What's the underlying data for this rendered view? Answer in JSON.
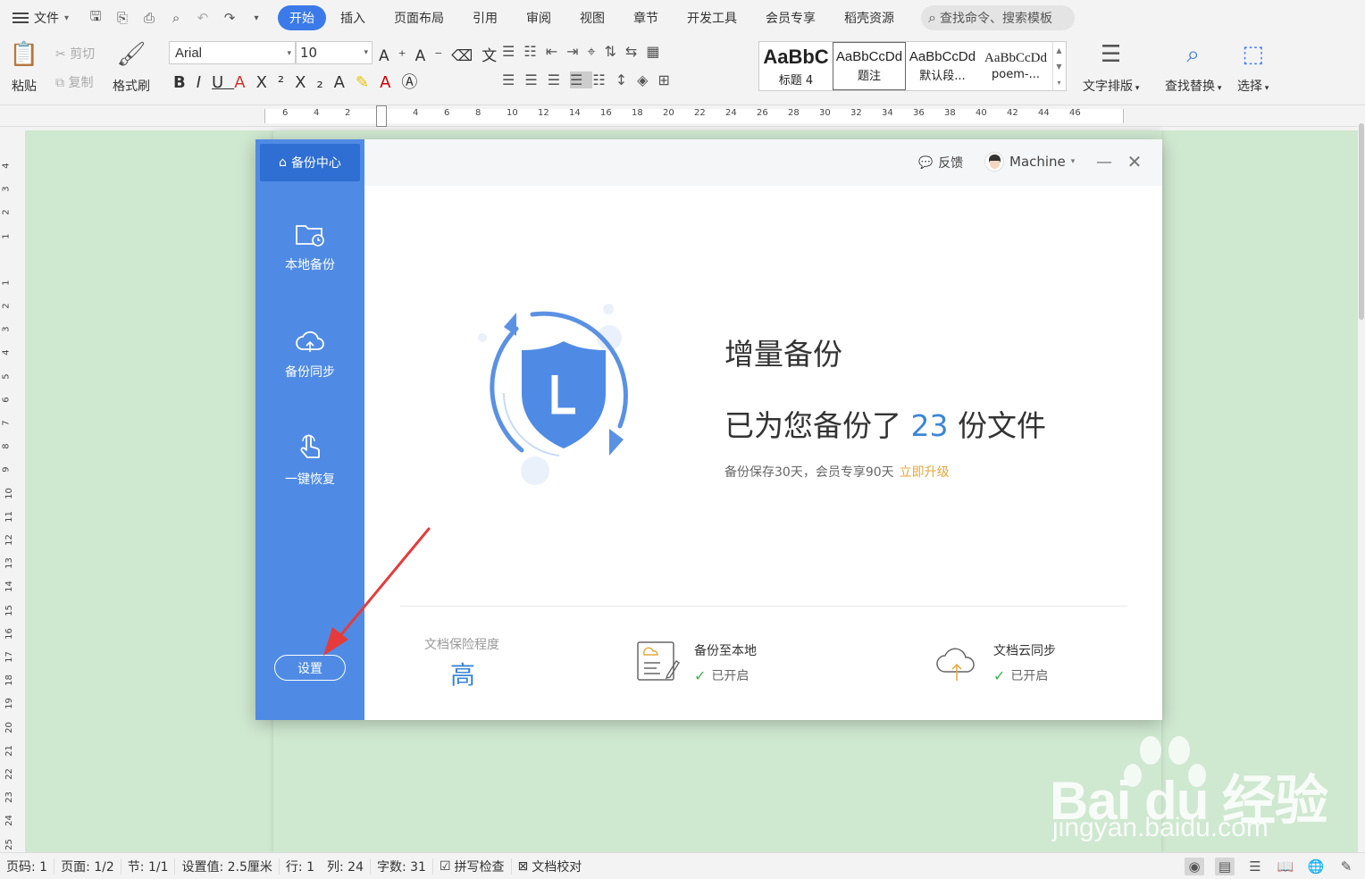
{
  "menubar": {
    "file_label": "文件",
    "tabs": [
      {
        "label": "开始",
        "active": true
      },
      {
        "label": "插入"
      },
      {
        "label": "页面布局"
      },
      {
        "label": "引用"
      },
      {
        "label": "审阅"
      },
      {
        "label": "视图"
      },
      {
        "label": "章节"
      },
      {
        "label": "开发工具"
      },
      {
        "label": "会员专享"
      },
      {
        "label": "稻壳资源"
      }
    ],
    "search_placeholder": "查找命令、搜索模板"
  },
  "ribbon": {
    "paste": "粘贴",
    "cut": "剪切",
    "copy": "复制",
    "format_painter": "格式刷",
    "font_name": "Arial",
    "font_size": "10",
    "styles": [
      {
        "preview": "AaBbC",
        "name": "标题 4"
      },
      {
        "preview": "AaBbCcDd",
        "name": "题注",
        "selected": true
      },
      {
        "preview": "AaBbCcDd",
        "name": "默认段..."
      },
      {
        "preview": "AaBbCcDd",
        "name": "poem-..."
      }
    ],
    "text_layout": "文字排版",
    "find_replace": "查找替换",
    "select": "选择"
  },
  "ruler": {
    "h_ticks": [
      "6",
      "4",
      "2",
      "2",
      "4",
      "6",
      "8",
      "10",
      "12",
      "14",
      "16",
      "18",
      "20",
      "22",
      "24",
      "26",
      "28",
      "30",
      "32",
      "34",
      "36",
      "38",
      "40",
      "42",
      "44",
      "46"
    ],
    "v_ticks": [
      "4",
      "3",
      "2",
      "1",
      "1",
      "2",
      "3",
      "4",
      "5",
      "6",
      "7",
      "8",
      "9",
      "10",
      "11",
      "12",
      "13",
      "14",
      "15",
      "16",
      "17",
      "18",
      "19",
      "20",
      "21",
      "22",
      "23",
      "24",
      "25"
    ]
  },
  "dialog": {
    "sidebar": {
      "header": "备份中心",
      "items": [
        {
          "label": "本地备份",
          "icon": "folder-clock-icon"
        },
        {
          "label": "备份同步",
          "icon": "cloud-upload-icon"
        },
        {
          "label": "一键恢复",
          "icon": "hand-pointer-icon"
        }
      ],
      "settings_label": "设置"
    },
    "topbar": {
      "feedback": "反馈",
      "username": "Machine"
    },
    "hero": {
      "title": "增量备份",
      "count_prefix": "已为您备份了 ",
      "count": "23",
      "count_suffix": " 份文件",
      "note": "备份保存30天，会员专享90天",
      "upgrade": "立即升级"
    },
    "footer": {
      "protect_label": "文档保险程度",
      "protect_level": "高",
      "local_backup": {
        "name": "备份至本地",
        "status": "已开启"
      },
      "cloud_sync": {
        "name": "文档云同步",
        "status": "已开启"
      }
    }
  },
  "watermark": {
    "brand": "Bai du 经验",
    "url": "jingyan.baidu.com"
  },
  "statusbar": {
    "page_code": "页码: 1",
    "page": "页面: 1/2",
    "section": "节: 1/1",
    "setting": "设置值: 2.5厘米",
    "row": "行: 1",
    "col": "列: 24",
    "word_count": "字数: 31",
    "spell_check": "拼写检查",
    "doc_check": "文档校对"
  },
  "colors": {
    "accent": "#3b7ae8",
    "sidebar": "#4f8be5",
    "doc_bg": "#cfe8d0",
    "count": "#3b86d6",
    "upgrade": "#e5a63d",
    "check": "#3ab24a"
  }
}
